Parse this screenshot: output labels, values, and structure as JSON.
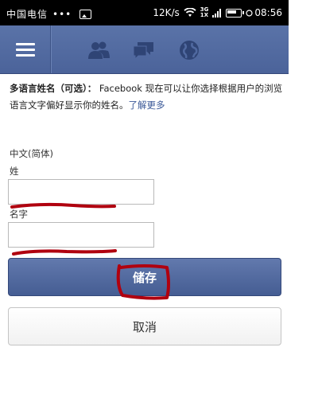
{
  "status_bar": {
    "carrier": "中国电信",
    "dots": "•••",
    "speed": "12K/s",
    "network_top": "3G",
    "network_bottom": "1X",
    "battery_icon": "battery-icon",
    "time": "08:56"
  },
  "nav": {
    "icons": [
      "menu-icon",
      "friends-icon",
      "messages-icon",
      "globe-icon"
    ]
  },
  "intro": {
    "heading": "多语言姓名（可选）：",
    "text": " Facebook 现在可以让你选择根据用户的浏览语言文字偏好显示你的姓名。",
    "link": "了解更多"
  },
  "form": {
    "language": "中文(简体)",
    "last_name_label": "姓",
    "last_name_value": "",
    "first_name_label": "名字",
    "first_name_value": ""
  },
  "buttons": {
    "save": "储存",
    "cancel": "取消"
  },
  "colors": {
    "facebook_blue": "#4b639a",
    "link": "#3b5998",
    "annotation_red": "#b0000f"
  }
}
